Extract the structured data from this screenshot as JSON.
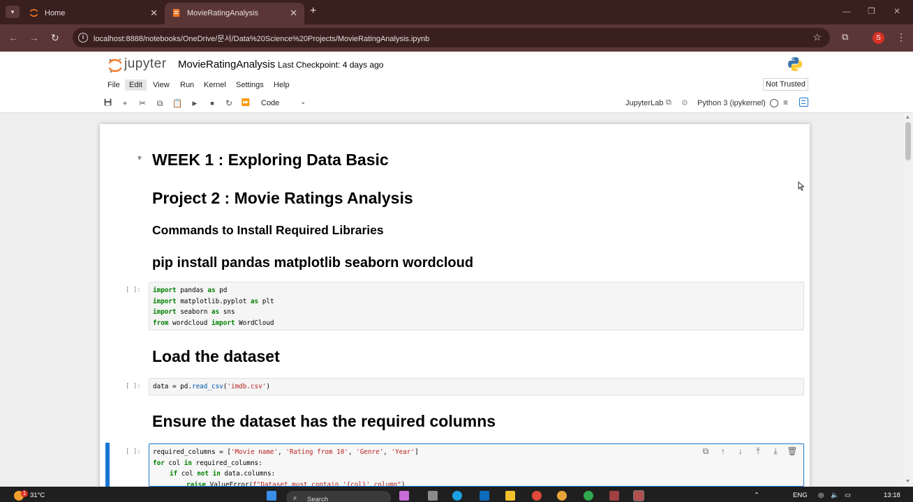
{
  "browser": {
    "tabs": [
      {
        "label": "Home",
        "active": false
      },
      {
        "label": "MovieRatingAnalysis",
        "active": true
      }
    ],
    "url": "localhost:8888/notebooks/OneDrive/문서/Data%20Science%20Projects/MovieRatingAnalysis.ipynb",
    "profile_initial": "S",
    "colors": {
      "frame": "#3a1f1f",
      "toolbar": "#5b3636"
    }
  },
  "jupyter": {
    "logo_text": "jupyter",
    "notebook_title": "MovieRatingAnalysis",
    "checkpoint": "Last Checkpoint: 4 days ago",
    "menu": [
      "File",
      "Edit",
      "View",
      "Run",
      "Kernel",
      "Settings",
      "Help"
    ],
    "trust_status": "Not Trusted",
    "cell_type": "Code",
    "jupyterlab_link": "JupyterLab",
    "kernel": "Python 3 (ipykernel)",
    "accent_color": "#1976d2"
  },
  "cells": {
    "h_week": "WEEK 1 : Exploring Data Basic",
    "h_project": "Project 2 : Movie Ratings Analysis",
    "h_commands": "Commands to Install Required Libraries",
    "h_pip": "pip install pandas matplotlib seaborn wordcloud",
    "prompt": "[ ]:",
    "h_load": "Load the dataset",
    "h_ensure": "Ensure the dataset has the required columns",
    "code1": [
      [
        "import",
        " pandas ",
        "as",
        " pd"
      ],
      [
        "import",
        " matplotlib.pyplot ",
        "as",
        " plt"
      ],
      [
        "import",
        " seaborn ",
        "as",
        " sns"
      ],
      [
        "from",
        " wordcloud ",
        "import",
        " WordCloud"
      ]
    ],
    "code2": {
      "pre": "data = pd.",
      "fn": "read_csv",
      "open": "(",
      "str": "'imdb.csv'",
      "close": ")"
    },
    "code3": {
      "l1_pre": "required_columns = [",
      "l1_items": [
        "'Movie name'",
        "'Rating from 10'",
        "'Genre'",
        "'Year'"
      ],
      "l1_sep": ", ",
      "l1_post": "]",
      "l2_kw1": "for",
      "l2_mid": " col ",
      "l2_kw2": "in",
      "l2_post": " required_columns:",
      "l3_kw1": "if",
      "l3_mid": " col ",
      "l3_kw2": "not in",
      "l3_post": " data.columns:",
      "l4_kw": "raise",
      "l4_mid": " ValueError(",
      "l4_str": "f\"Dataset must contain '{col}' column\"",
      "l4_post": ")"
    }
  },
  "taskbar": {
    "weather": "31°C",
    "weather_badge": "1",
    "search_placeholder": "Search",
    "language": "ENG",
    "time": "13:18"
  }
}
